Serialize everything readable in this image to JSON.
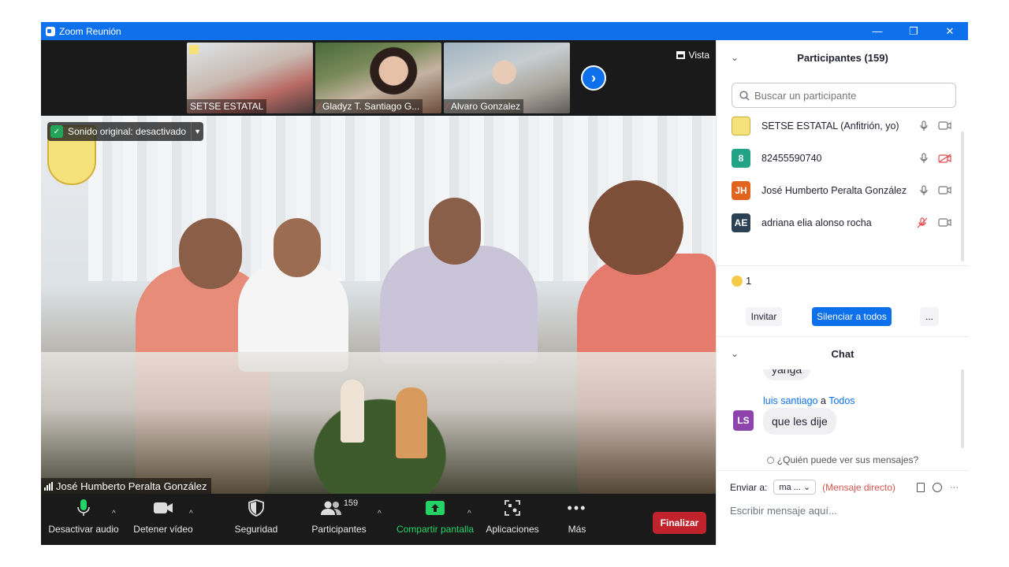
{
  "window": {
    "title": "Zoom Reunión",
    "minimize": "—",
    "restore": "❐",
    "close": "✕"
  },
  "thumbnails": [
    {
      "name": "SETSE ESTATAL",
      "muted": false
    },
    {
      "name": "Gladyz T. Santiago G...",
      "muted": true
    },
    {
      "name": "Alvaro Gonzalez",
      "muted": true
    }
  ],
  "view_label": "Vista",
  "original_sound": "Sonido original: desactivado",
  "active_speaker": "José Humberto Peralta González",
  "toolbar": {
    "audio": "Desactivar audio",
    "video": "Detener vídeo",
    "security": "Seguridad",
    "participants": "Participantes",
    "participants_count": "159",
    "share": "Compartir pantalla",
    "apps": "Aplicaciones",
    "more": "Más",
    "end": "Finalizar"
  },
  "participants_panel": {
    "title": "Participantes (159)",
    "search_placeholder": "Buscar un participante",
    "items": [
      {
        "initials": "",
        "name": "SETSE ESTATAL (Anfitrión, yo)",
        "color": "#ffffff",
        "mic_muted": false,
        "video_off": false
      },
      {
        "initials": "8",
        "name": "82455590740",
        "color": "#23a386",
        "mic_muted": false,
        "video_off": true
      },
      {
        "initials": "JH",
        "name": "José Humberto Peralta González",
        "color": "#e0641e",
        "mic_muted": false,
        "video_off": false
      },
      {
        "initials": "AE",
        "name": "adriana elia alonso rocha",
        "color": "#2d4155",
        "mic_muted": true,
        "video_off": false
      }
    ],
    "reaction_count": "1",
    "invite": "Invitar",
    "mute_all": "Silenciar a todos",
    "more": "..."
  },
  "chat": {
    "title": "Chat",
    "prev_message": "yanga",
    "message": {
      "sender": "luis santiago",
      "to_word": "a",
      "recipient": "Todos",
      "initials": "LS",
      "color": "#8e44ad",
      "text": "que les dije"
    },
    "who_can_see": "¿Quién puede ver sus mensajes?",
    "send_to_label": "Enviar a:",
    "send_to_value": "ma ...",
    "direct_message": "(Mensaje directo)",
    "compose_placeholder": "Escribir mensaje aquí..."
  }
}
